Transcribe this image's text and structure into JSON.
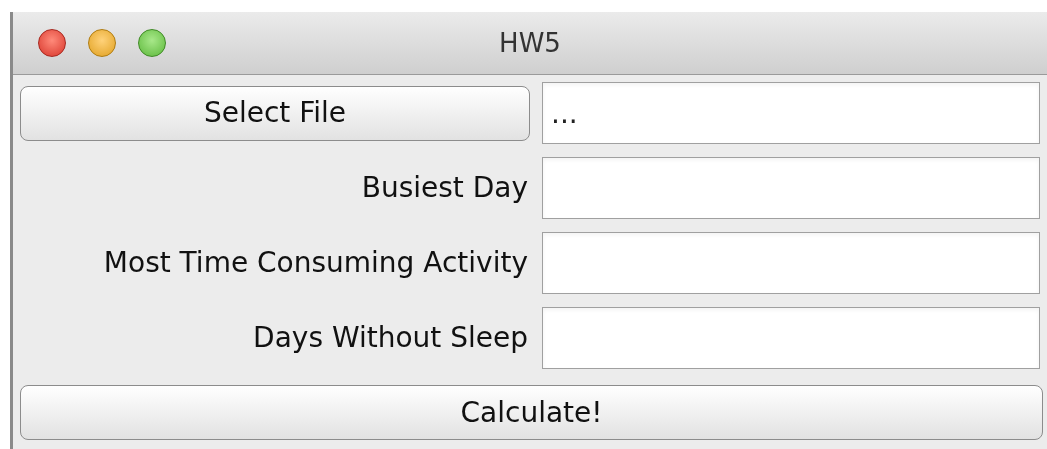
{
  "window": {
    "title": "HW5"
  },
  "select_file": {
    "label": "Select File",
    "value": "..."
  },
  "fields": [
    {
      "label": "Busiest Day"
    },
    {
      "label": "Most Time Consuming Activity"
    },
    {
      "label": "Days Without Sleep"
    }
  ],
  "calculate": {
    "label": "Calculate!"
  }
}
